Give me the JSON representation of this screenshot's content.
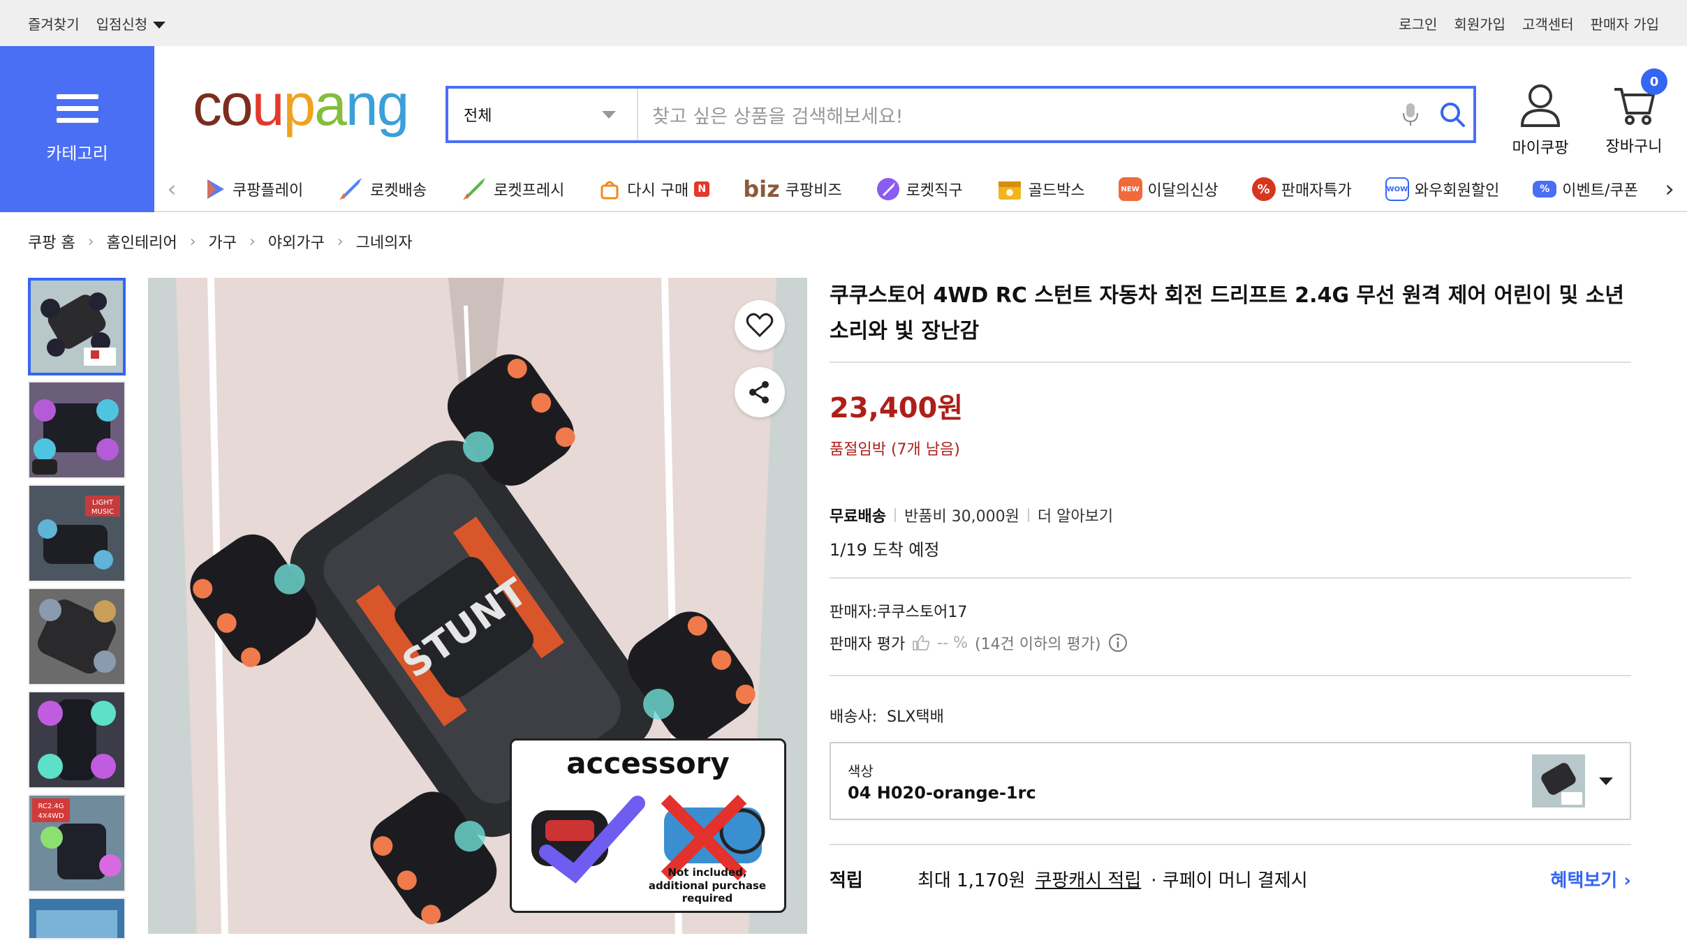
{
  "topbar": {
    "bookmarks": "즐겨찾기",
    "seller_apply": "입점신청",
    "login": "로그인",
    "signup": "회원가입",
    "support": "고객센터",
    "seller_signup": "판매자 가입"
  },
  "header": {
    "category_label": "카테고리",
    "logo": {
      "c": "c",
      "o": "o",
      "u": "u",
      "p": "p",
      "a": "a",
      "n": "n",
      "g": "g"
    },
    "search": {
      "category": "전체",
      "placeholder": "찾고 싶은 상품을 검색해보세요!"
    },
    "my_coupang": "마이쿠팡",
    "cart": "장바구니",
    "cart_count": "0"
  },
  "nav": {
    "items": [
      {
        "label": "쿠팡플레이",
        "icon": "play-icon"
      },
      {
        "label": "로켓배송",
        "icon": "rocket-icon"
      },
      {
        "label": "로켓프레시",
        "icon": "rocket-fresh-icon"
      },
      {
        "label": "다시 구매",
        "icon": "rebuy-icon",
        "badge": "N"
      },
      {
        "label": "쿠팡비즈",
        "icon": "biz-icon",
        "prefix": "biz"
      },
      {
        "label": "로켓직구",
        "icon": "rocket-global-icon"
      },
      {
        "label": "골드박스",
        "icon": "goldbox-icon"
      },
      {
        "label": "이달의신상",
        "icon": "new-icon",
        "badge": "NEW"
      },
      {
        "label": "판매자특가",
        "icon": "percent-icon",
        "badge": "%"
      },
      {
        "label": "와우회원할인",
        "icon": "wow-icon",
        "badge": "WOW"
      },
      {
        "label": "이벤트/쿠폰",
        "icon": "coupon-icon",
        "badge": "%"
      }
    ]
  },
  "breadcrumb": [
    "쿠팡 홈",
    "홈인테리어",
    "가구",
    "야외가구",
    "그네의자"
  ],
  "product": {
    "title": "쿠쿠스토어 4WD RC 스턴트 자동차 회전 드리프트 2.4G 무선 원격 제어 어린이 및 소년 소리와 빛 장난감",
    "price": "23,400원",
    "stock": "품절임박 (7개 남음)",
    "free_shipping": "무료배송",
    "return_fee": "반품비 30,000원",
    "learn_more": "더 알아보기",
    "eta": "1/19 도착 예정",
    "seller": "판매자:쿠쿠스토어17",
    "seller_rating_label": "판매자 평가",
    "seller_rating_value": "-- %",
    "seller_rating_note": "(14건 이하의 평가)",
    "carrier": "배송사:  SLX택배",
    "option_label": "색상",
    "option_value": "04 H020-orange-1rc",
    "reward_label": "적립",
    "reward_text": "최대 1,170원",
    "reward_link": "쿠팡캐시 적립",
    "reward_tail": "· 쿠페이 머니 결제시",
    "benefit_link": "혜택보기"
  },
  "image": {
    "accessory_title": "accessory",
    "not_included": "Not included, additional purchase required",
    "car_text": "STUNT",
    "thumb3_text1": "LIGHT",
    "thumb3_text2": "MUSIC",
    "thumb6_text1": "RC2.4G",
    "thumb6_text2": "4X4WD"
  },
  "colors": {
    "brand_blue": "#4a6ff5",
    "price_red": "#ae1f1a",
    "link_blue": "#3466f4"
  }
}
